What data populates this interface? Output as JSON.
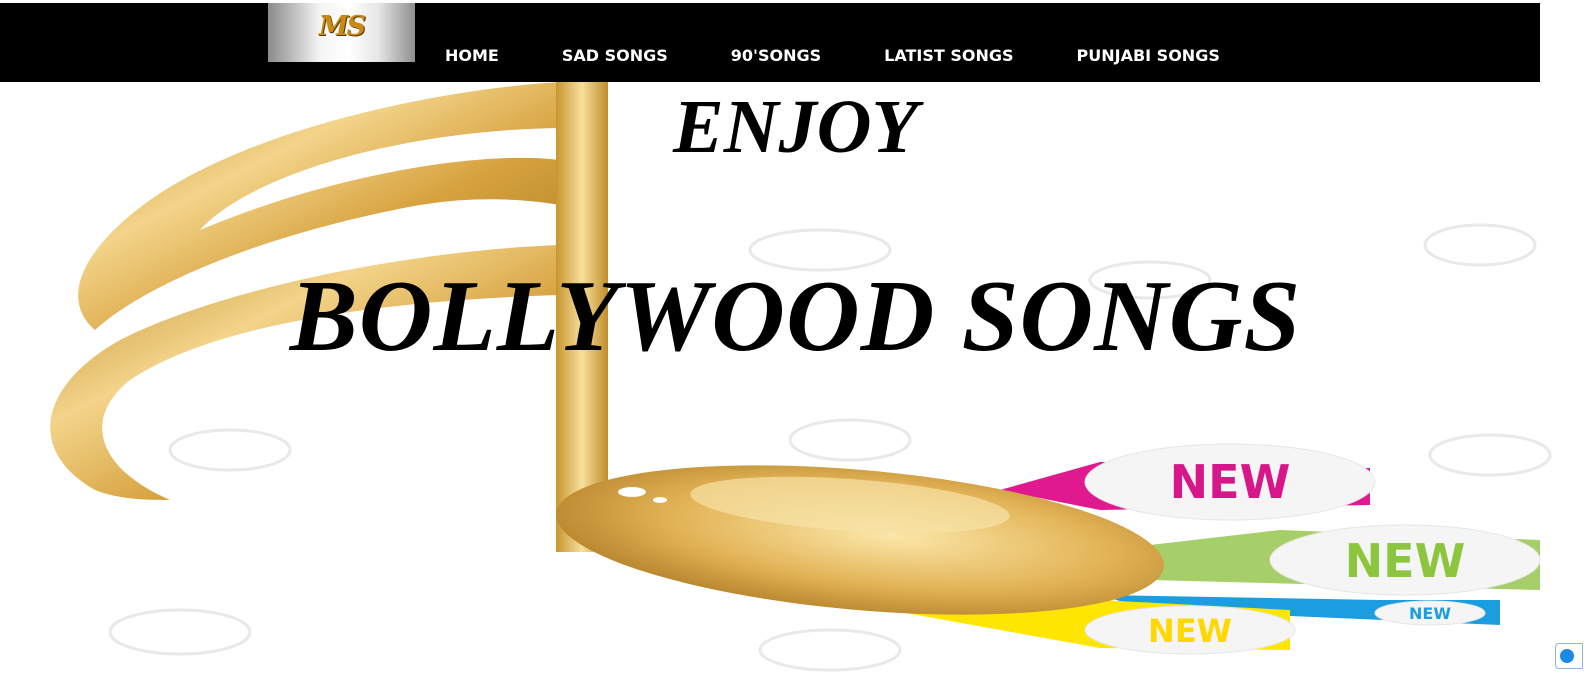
{
  "logo": {
    "text": "MS"
  },
  "nav": {
    "items": [
      {
        "label": "HOME"
      },
      {
        "label": "SAD SONGS"
      },
      {
        "label": "90'SONGS"
      },
      {
        "label": "LATIST SONGS"
      },
      {
        "label": "PUNJABI SONGS"
      }
    ]
  },
  "hero": {
    "title_top": "ENJOY",
    "title_main": "BOLLYWOOD SONGS",
    "badge_text": "NEW",
    "colors": {
      "gold": "#d8a53c",
      "magenta": "#e0198f",
      "green": "#8cc63f",
      "blue": "#1a9ee0",
      "yellow": "#ffe600"
    }
  }
}
